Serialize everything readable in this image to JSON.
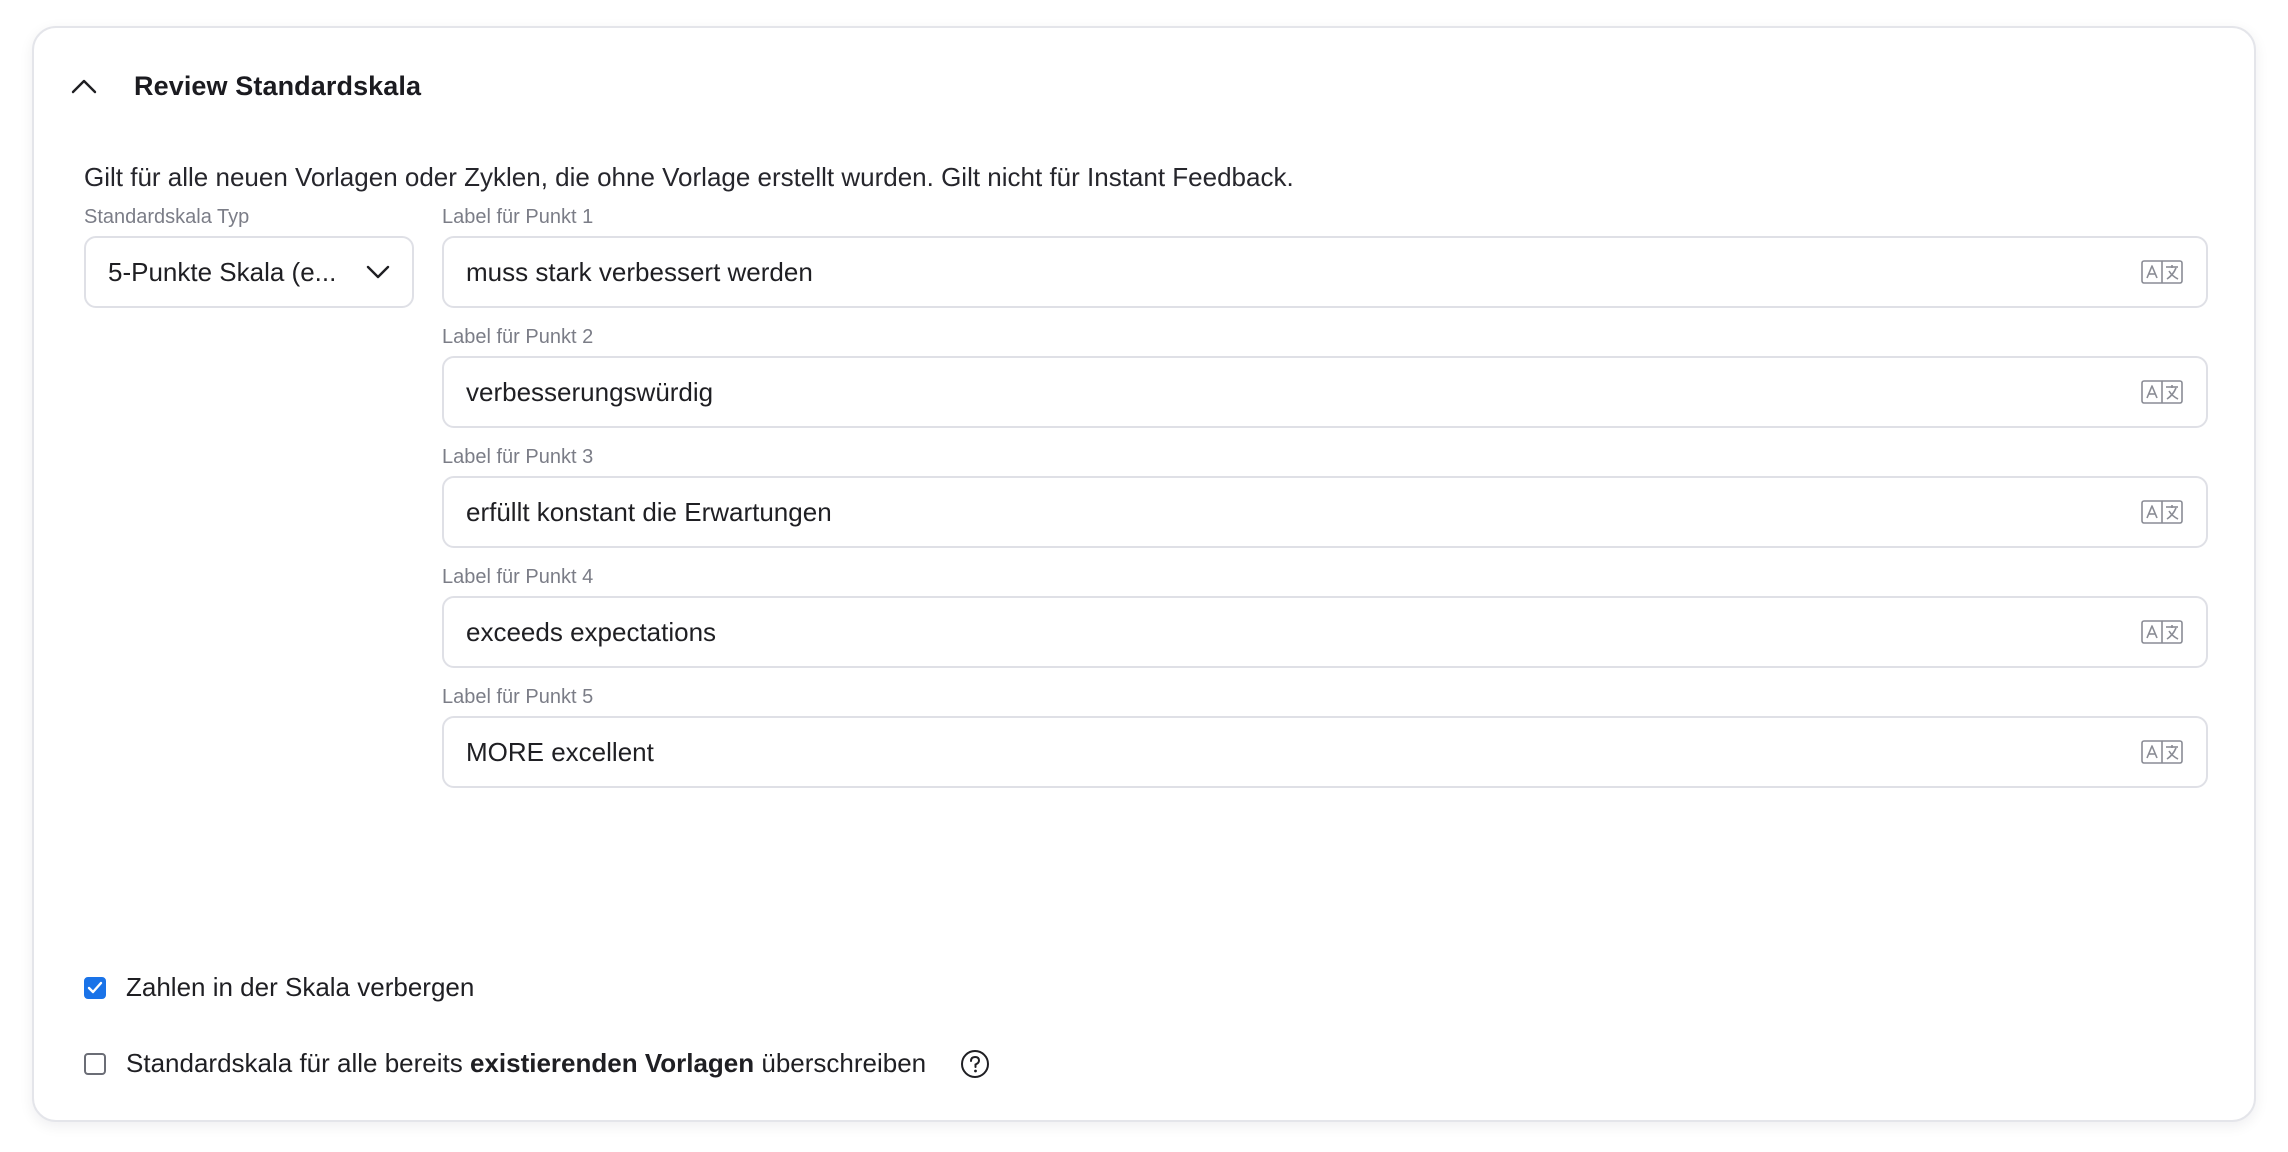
{
  "section": {
    "title": "Review Standardskala",
    "description": "Gilt für alle neuen Vorlagen oder Zyklen, die ohne Vorlage erstellt wurden. Gilt nicht für Instant Feedback."
  },
  "scale_type": {
    "label": "Standardskala Typ",
    "value": "5-Punkte Skala (e..."
  },
  "points": [
    {
      "label": "Label für Punkt 1",
      "value": "muss stark verbessert werden"
    },
    {
      "label": "Label für Punkt 2",
      "value": "verbesserungswürdig"
    },
    {
      "label": "Label für Punkt 3",
      "value": "erfüllt konstant die Erwartungen"
    },
    {
      "label": "Label für Punkt 4",
      "value": "exceeds expectations"
    },
    {
      "label": "Label für Punkt 5",
      "value": "MORE excellent"
    }
  ],
  "options": {
    "hide_numbers": {
      "label": "Zahlen in der Skala verbergen",
      "checked": true
    },
    "overwrite_templates": {
      "label_before": "Standardskala für alle bereits ",
      "label_bold": "existierenden Vorlagen",
      "label_after": " überschreiben",
      "checked": false
    }
  },
  "icons": {
    "collapse": "chevron-up-icon",
    "dropdown": "chevron-down-icon",
    "translate": "translate-icon",
    "help": "help-icon",
    "check": "check-icon"
  },
  "colors": {
    "checkbox_accent": "#1a73e8",
    "border": "#dfe0e6",
    "muted_text": "#7b7d87"
  }
}
